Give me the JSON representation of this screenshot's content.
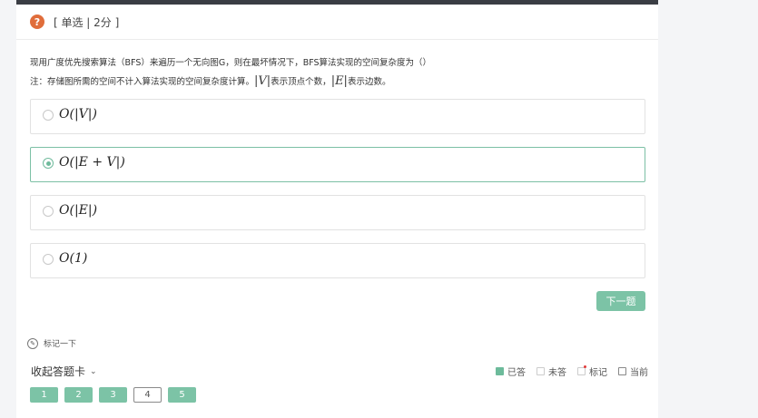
{
  "question": {
    "type_label": "[ 单选 | 2分 ]",
    "stem": "现用广度优先搜索算法（BFS）来遍历一个无向图G，则在最坏情况下，BFS算法实现的空间复杂度为（）",
    "note_prefix": "注：存储图所需的空间不计入算法实现的空间复杂度计算。",
    "note_v": "|V|",
    "note_v_text": "表示顶点个数，",
    "note_e": "|E|",
    "note_e_text": "表示边数。"
  },
  "options": [
    {
      "label": "O(|V|)",
      "selected": false
    },
    {
      "label": "O(|E + V|)",
      "selected": true
    },
    {
      "label": "O(|E|)",
      "selected": false
    },
    {
      "label": "O(1)",
      "selected": false
    }
  ],
  "next_label": "下一题",
  "mark_label": "标记一下",
  "collapse_label": "收起答题卡",
  "legend": {
    "answered": "已答",
    "unanswered": "未答",
    "flagged": "标记",
    "current": "当前"
  },
  "answer_card": [
    {
      "num": "1",
      "state": "answered"
    },
    {
      "num": "2",
      "state": "answered"
    },
    {
      "num": "3",
      "state": "answered"
    },
    {
      "num": "4",
      "state": "current"
    },
    {
      "num": "5",
      "state": "answered"
    }
  ],
  "colors": {
    "accent": "#7cc3a6",
    "question_icon": "#e06d3b",
    "header_bar": "#3a3d44"
  }
}
